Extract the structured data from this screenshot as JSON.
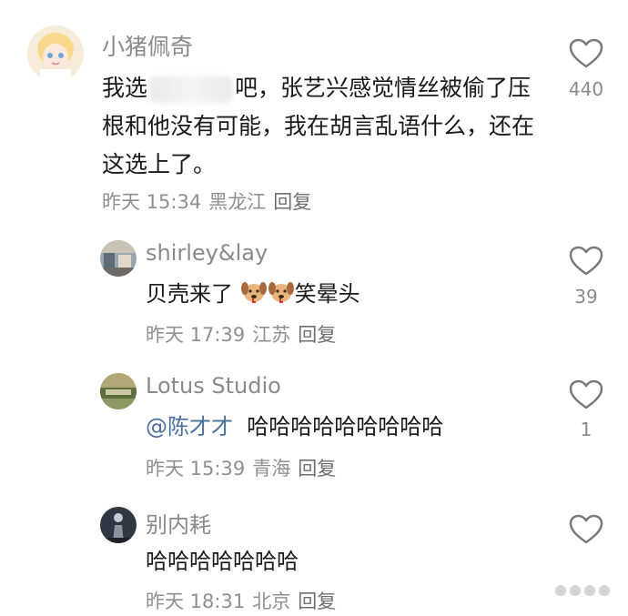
{
  "comments": [
    {
      "username": "小猪佩奇",
      "text_before_blur": "我选",
      "text_after_blur": "吧，张艺兴感觉情丝被偷了压根和他没有可能，我在胡言乱语什么，还在这选上了。",
      "date": "昨天 15:34",
      "location": "黑龙江",
      "reply_label": "回复",
      "likes": "440"
    },
    {
      "username": "shirley&lay",
      "text_before": "贝壳来了",
      "text_after": "笑晕头",
      "emoji": "dog-face-emoji",
      "date": "昨天 17:39",
      "location": "江苏",
      "reply_label": "回复",
      "likes": "39"
    },
    {
      "username": "Lotus Studio",
      "mention": "@陈才才",
      "text": "哈哈哈哈哈哈哈哈哈",
      "date": "昨天 15:39",
      "location": "青海",
      "reply_label": "回复",
      "likes": "1"
    },
    {
      "username": "别内耗",
      "text": "哈哈哈哈哈哈哈",
      "date": "昨天 18:31",
      "location": "北京",
      "reply_label": "回复",
      "likes": ""
    }
  ],
  "icons": {
    "like": "heart-outline-icon",
    "watermark": "dots-watermark-icon"
  },
  "colors": {
    "username": "#8a8a8a",
    "text": "#1a1a1a",
    "meta": "#8f8f8f",
    "mention": "#4a6f9a"
  }
}
